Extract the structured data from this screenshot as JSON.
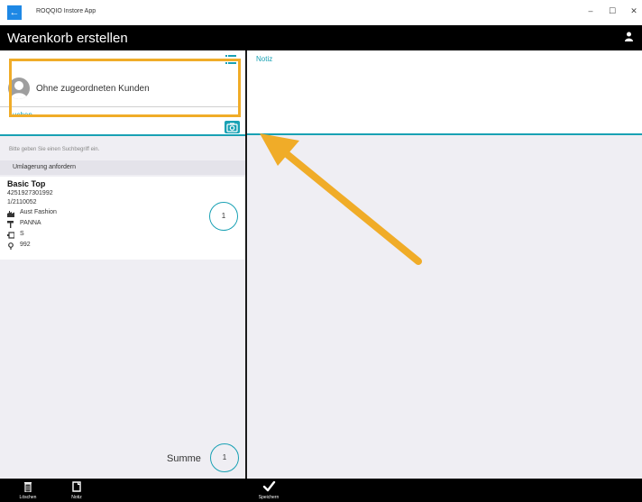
{
  "window": {
    "app_title": "ROQQIO Instore App",
    "controls": {
      "minimize": "–",
      "maximize": "☐",
      "close": "✕"
    }
  },
  "header": {
    "title": "Warenkorb erstellen"
  },
  "customer": {
    "name": "Ohne zugeordneten Kunden",
    "search_label": "Suchen",
    "search_label_visible": "uchen",
    "hint": "Bitte geben Sie einen Suchbegriff ein."
  },
  "umlagerung": {
    "label": "Umlagerung anfordern"
  },
  "product": {
    "name": "Basic Top",
    "ean": "4251927301992",
    "article_no": "1/2110052",
    "supplier": "Aust Fashion",
    "color": "PANNA",
    "size": "S",
    "location": "992",
    "quantity": "1"
  },
  "summe": {
    "label": "Summe",
    "value": "1"
  },
  "note": {
    "label": "Notiz"
  },
  "bottombar": {
    "delete_label": "Löschen",
    "note_label": "Notiz",
    "save_label": "Speichern"
  },
  "colors": {
    "accent": "#19a1b4",
    "highlight": "#f0ac28",
    "header_bg": "#000000",
    "pane_bg": "#efeef3",
    "back_button": "#1e88e5"
  },
  "icons": {
    "back": "back-arrow-icon",
    "user": "user-account-icon",
    "list": "list-icon",
    "avatar": "person-avatar-icon",
    "camera": "camera-icon",
    "supplier": "factory-icon",
    "color": "paint-roller-icon",
    "size": "size-tag-icon",
    "location": "location-pin-icon",
    "delete": "trash-icon",
    "note": "note-icon",
    "save": "checkmark-icon"
  }
}
